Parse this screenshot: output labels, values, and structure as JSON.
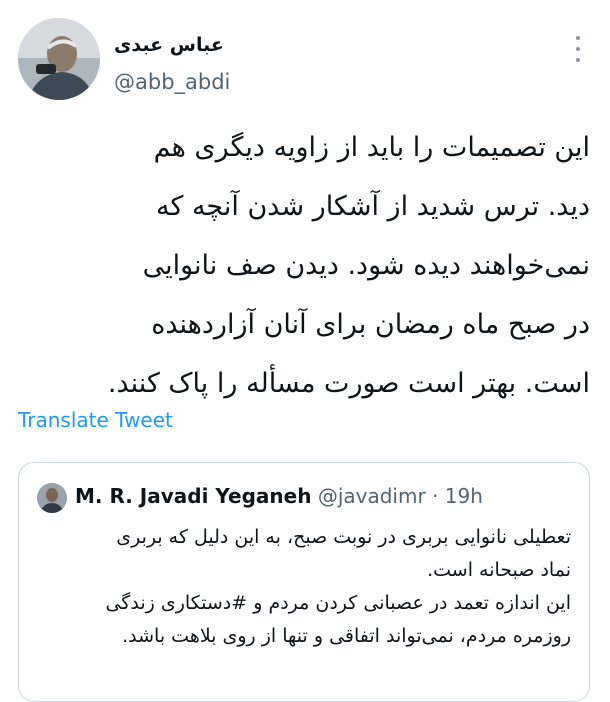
{
  "tweet": {
    "display_name": "عباس عبدی",
    "handle": "@abb_abdi",
    "more_icon": "more-vertical-icon",
    "text": "این تصمیمات را باید از زاویه دیگری هم\nدید. ترس شدید از آشکار شدن آنچه که\nنمی‌خواهند دیده شود. دیدن صف نانوایی\nدر صبح ماه رمضان برای آنان آزاردهنده\nاست. بهتر است صورت مسأله را پاک کنند.",
    "translate_label": "Translate Tweet"
  },
  "quoted": {
    "name": "M. R. Javadi Yeganeh",
    "handle": "@javadimr",
    "separator": "·",
    "time": "19h",
    "text": "تعطیلی نانوایی بربری در نوبت صبح، به این دلیل که بربری\nنماد صبحانه است.\nاین اندازه تعمد در عصبانی کردن مردم و #دستکاری زندگی\nروزمره مردم، نمی‌تواند اتفاقی و تنها از روی بلاهت باشد."
  },
  "colors": {
    "link": "#1d9bf0",
    "secondary_text": "#536471",
    "border": "#cfd9de"
  }
}
